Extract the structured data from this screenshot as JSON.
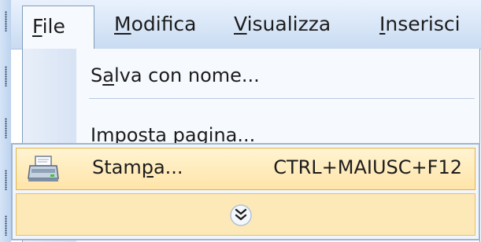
{
  "menubar": {
    "items": [
      {
        "label": "File",
        "accel": "F",
        "rest": "ile",
        "open": true
      },
      {
        "label": "Modifica",
        "accel": "M",
        "rest": "odifica"
      },
      {
        "label": "Visualizza",
        "accel": "V",
        "rest": "isualizza"
      },
      {
        "label": "Inserisci",
        "accel": "I",
        "rest": "nserisci"
      }
    ]
  },
  "file_menu": {
    "salva": {
      "pre": "S",
      "accel": "a",
      "post": "lva con nome..."
    },
    "imposta": {
      "accel": "I",
      "post": "mposta pagina..."
    },
    "stampa": {
      "pre": "Stam",
      "accel": "p",
      "post": "a...",
      "shortcut": "CTRL+MAIUSC+F12",
      "icon": "printer-icon"
    },
    "expand": {
      "icon": "chevron-double-down-icon"
    }
  },
  "colors": {
    "menubar_bg": "#dbe8f8",
    "highlight_bg": "#ffe4a8",
    "highlight_border": "#e0b44c",
    "expand_bg": "#fde9b8"
  }
}
